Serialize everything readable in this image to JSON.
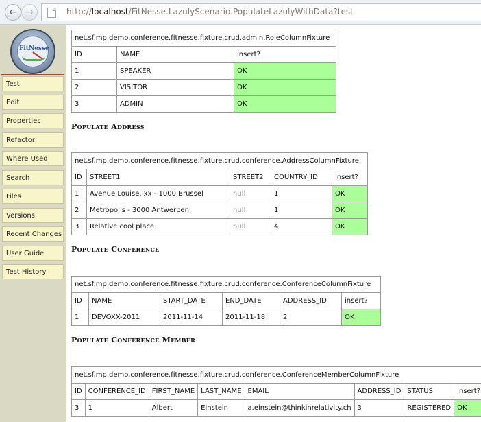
{
  "browser": {
    "back_glyph": "←",
    "forward_glyph": "→",
    "url_prefix": "http://",
    "url_host": "localhost",
    "url_path": "/FitNesse.LazulyScenario.PopulateLazulyWithData?test"
  },
  "logo": {
    "text": "FitNesse"
  },
  "sidebar": {
    "items": [
      {
        "label": "Test"
      },
      {
        "label": "Edit"
      },
      {
        "label": "Properties"
      },
      {
        "label": "Refactor"
      },
      {
        "label": "Where Used"
      },
      {
        "label": "Search"
      },
      {
        "label": "Files"
      },
      {
        "label": "Versions"
      },
      {
        "label": "Recent Changes"
      },
      {
        "label": "User Guide"
      },
      {
        "label": "Test History"
      }
    ]
  },
  "role_table": {
    "fixture": "net.sf.mp.demo.conference.fitnesse.fixture.crud.admin.RoleColumnFixture",
    "headers": [
      "ID",
      "NAME",
      "insert?"
    ],
    "rows": [
      [
        "1",
        "SPEAKER",
        "OK"
      ],
      [
        "2",
        "VISITOR",
        "OK"
      ],
      [
        "3",
        "ADMIN",
        "OK"
      ]
    ]
  },
  "address_section": {
    "title": "Populate Address",
    "fixture": "net.sf.mp.demo.conference.fitnesse.fixture.crud.conference.AddressColumnFixture",
    "headers": [
      "ID",
      "STREET1",
      "STREET2",
      "COUNTRY_ID",
      "insert?"
    ],
    "rows": [
      [
        "1",
        "Avenue Louise, xx - 1000 Brussel",
        "null",
        "1",
        "OK"
      ],
      [
        "2",
        "Metropolis - 3000 Antwerpen",
        "null",
        "1",
        "OK"
      ],
      [
        "3",
        "Relative cool place",
        "null",
        "4",
        "OK"
      ]
    ]
  },
  "conference_section": {
    "title": "Populate Conference",
    "fixture": "net.sf.mp.demo.conference.fitnesse.fixture.crud.conference.ConferenceColumnFixture",
    "headers": [
      "ID",
      "NAME",
      "START_DATE",
      "END_DATE",
      "ADDRESS_ID",
      "insert?"
    ],
    "rows": [
      [
        "1",
        "DEVOXX-2011",
        "2011-11-14",
        "2011-11-18",
        "2",
        "OK"
      ]
    ]
  },
  "member_section": {
    "title": "Populate Conference Member",
    "fixture": "net.sf.mp.demo.conference.fitnesse.fixture.crud.conference.ConferenceMemberColumnFixture",
    "headers": [
      "ID",
      "CONFERENCE_ID",
      "FIRST_NAME",
      "LAST_NAME",
      "EMAIL",
      "ADDRESS_ID",
      "STATUS",
      "insert?"
    ],
    "rows": [
      [
        "3",
        "1",
        "Albert",
        "Einstein",
        "a.einstein@thinkinrelativity.ch",
        "3",
        "REGISTERED",
        "OK"
      ]
    ]
  },
  "colors": {
    "pass": "#aaff99",
    "sidebar_bg": "#d9d9c4",
    "button_bg": "#f8f5c9"
  }
}
